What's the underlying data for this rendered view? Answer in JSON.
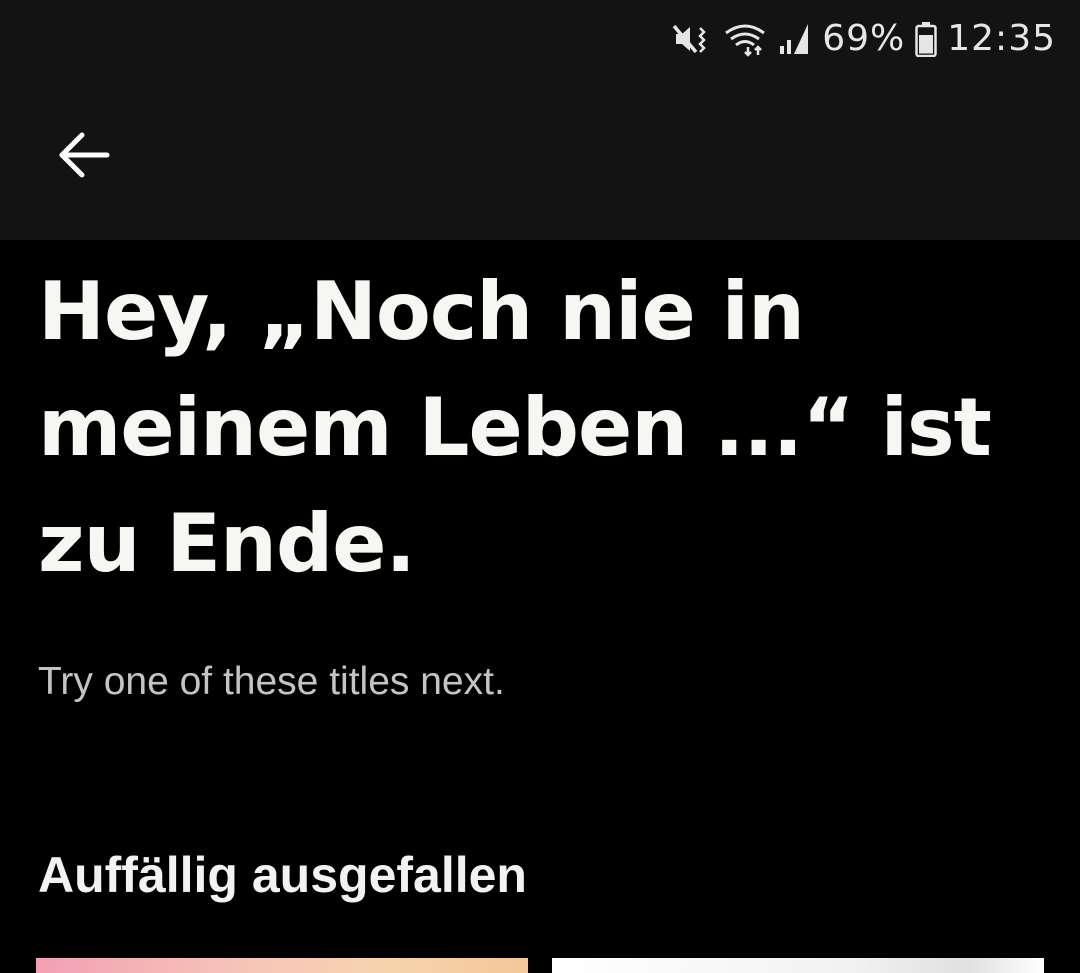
{
  "status_bar": {
    "icons": [
      "mute-vibrate-icon",
      "wifi-icon",
      "cell-signal-icon",
      "battery-icon"
    ],
    "battery": "69%",
    "time": "12:35"
  },
  "app_bar": {
    "back_icon": "arrow-left-icon"
  },
  "main": {
    "headline_lines": [
      "Hey, „Noch nie in",
      "meinem Leben ...“ ist",
      "zu Ende."
    ],
    "subtitle": "Try one of these titles next."
  },
  "section": {
    "title": "Auffällig ausgefallen",
    "cards": [
      {
        "colors": [
          "#f2a0b4",
          "#f7d4ae"
        ]
      },
      {
        "colors": [
          "#ffffff",
          "#e0e0e0"
        ]
      }
    ]
  },
  "colors": {
    "background": "#000000",
    "bar": "#131313",
    "headline": "#f6f6f2",
    "subtitle": "#c4c4c4"
  }
}
